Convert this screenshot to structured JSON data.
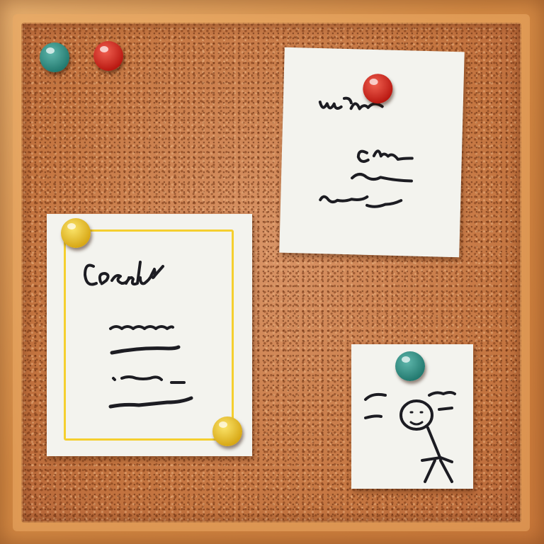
{
  "scene": {
    "subject": "corkboard",
    "colors": {
      "cork": "#c77a45",
      "frame": "#e0a560",
      "paper": "#f3f3ee",
      "note_border": "#f5cf2f",
      "pin_teal": "#2f8a80",
      "pin_red": "#d42a1e",
      "pin_yellow": "#f2cc3a",
      "ink": "#1c1c22"
    },
    "notes": [
      {
        "id": "left-note",
        "pins": [
          "yellow-pin",
          "yellow-pin"
        ]
      },
      {
        "id": "top-right-note",
        "pins": [
          "red-pin"
        ]
      },
      {
        "id": "small-note",
        "pins": [
          "teal-pin"
        ],
        "drawing": "stick-figure"
      }
    ],
    "loose_pins": [
      "teal-pin",
      "red-pin"
    ]
  }
}
